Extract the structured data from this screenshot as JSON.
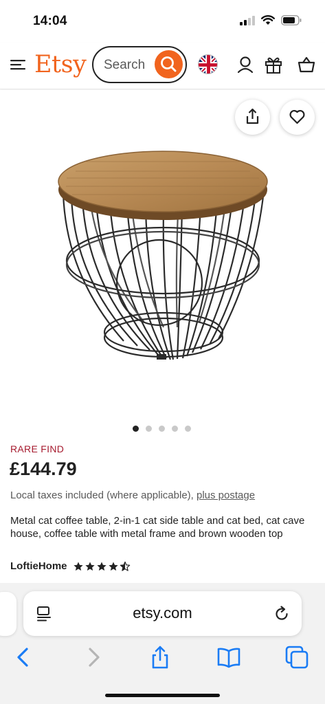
{
  "status_bar": {
    "time": "14:04"
  },
  "header": {
    "logo": "Etsy",
    "search_placeholder": "Search",
    "icons": [
      "menu-icon",
      "search-icon",
      "uk-flag-icon",
      "account-icon",
      "gift-icon",
      "basket-icon"
    ]
  },
  "gallery": {
    "image_count": 5,
    "active_index": 0,
    "actions": [
      "share-icon",
      "heart-icon"
    ]
  },
  "product": {
    "badge": "RARE FIND",
    "price": "£144.79",
    "tax_note": "Local taxes included (where applicable),",
    "postage_link": "plus postage",
    "title": "Metal cat coffee table, 2-in-1 cat side table and cat bed, cat cave house, coffee table with metal frame and brown wooden top",
    "shop": "LoftieHome",
    "rating": 4.5
  },
  "browser": {
    "url": "etsy.com",
    "toolbar_icons": [
      "back-icon",
      "forward-icon",
      "share-icon",
      "bookmarks-icon",
      "tabs-icon"
    ]
  },
  "colors": {
    "brand": "#F1641E",
    "badge": "#A61A2E",
    "browser_blue": "#1A7CF5"
  }
}
